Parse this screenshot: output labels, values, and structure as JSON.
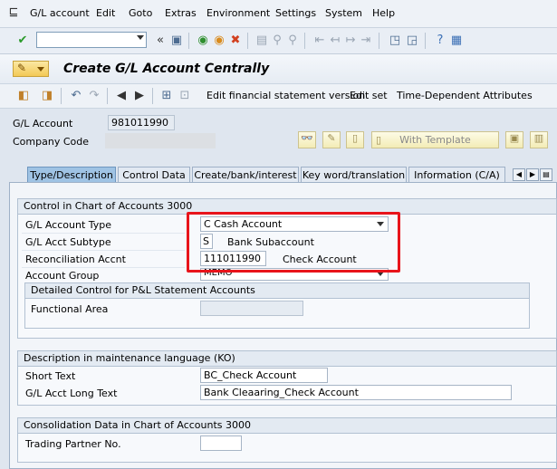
{
  "menu": {
    "items": [
      "G/L account",
      "Edit",
      "Goto",
      "Extras",
      "Environment",
      "Settings",
      "System",
      "Help"
    ]
  },
  "toolbar": {
    "command_value": ""
  },
  "title": {
    "text": "Create G/L Account Centrally"
  },
  "app_toolbar": {
    "edit_fs_version": "Edit financial statement version",
    "edit_set": "Edit set",
    "time_dependent": "Time-Dependent Attributes"
  },
  "header": {
    "gl_account_label": "G/L Account",
    "gl_account_value": "981011990",
    "company_code_label": "Company Code",
    "company_code_value": "",
    "with_template": "With Template"
  },
  "tabs": [
    "Type/Description",
    "Control Data",
    "Create/bank/interest",
    "Key word/translation",
    "Information (C/A)"
  ],
  "control_group": {
    "title": "Control in Chart of Accounts 3000",
    "account_type_label": "G/L Account Type",
    "account_type_value": "C Cash Account",
    "subtype_label": "G/L Acct Subtype",
    "subtype_code": "S",
    "subtype_text": "Bank Subaccount",
    "recon_label": "Reconciliation Accnt",
    "recon_value": "111011990",
    "recon_text": "Check Account",
    "account_group_label": "Account Group",
    "account_group_value": "MEMO",
    "pl_title": "Detailed Control for P&L Statement Accounts",
    "functional_area_label": "Functional Area",
    "functional_area_value": ""
  },
  "description_group": {
    "title": "Description in maintenance language (KO)",
    "short_text_label": "Short Text",
    "short_text_value": "BC_Check Account",
    "long_text_label": "G/L Acct Long Text",
    "long_text_value": "Bank Cleaaring_Check Account"
  },
  "consolidation_group": {
    "title": "Consolidation Data in Chart of Accounts 3000",
    "trading_partner_label": "Trading Partner No.",
    "trading_partner_value": ""
  },
  "colors": {
    "highlight": "#e8141b",
    "active_tab": "#9fc3e4"
  }
}
